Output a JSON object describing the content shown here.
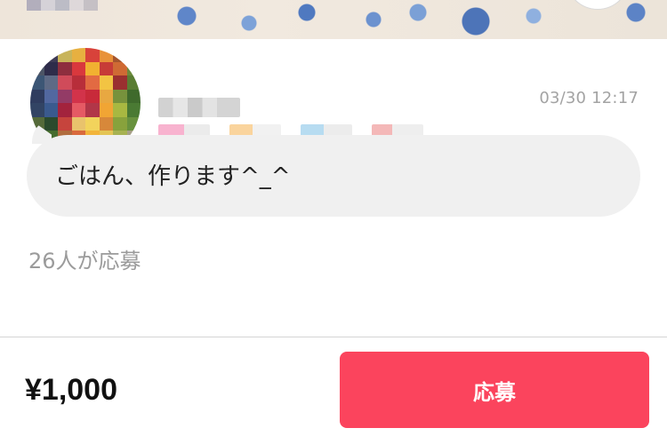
{
  "post": {
    "timestamp": "03/30 12:17",
    "message": "ごはん、作ります^_^",
    "applicants_text": "26人が応募"
  },
  "footer": {
    "price": "¥1,000",
    "apply_label": "応募"
  },
  "colors": {
    "accent": "#fb445d",
    "bubble_bg": "#f0f0f0",
    "muted_text": "#9b9b9b"
  }
}
